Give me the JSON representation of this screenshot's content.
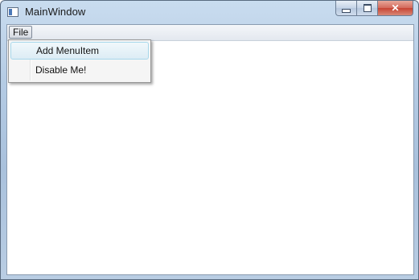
{
  "window": {
    "title": "MainWindow",
    "controls": {
      "minimize_icon": "minimize-icon",
      "maximize_icon": "maximize-icon",
      "close_icon": "close-icon",
      "close_glyph": "✕"
    }
  },
  "menubar": {
    "file_label": "File"
  },
  "file_menu": {
    "items": [
      {
        "label": "Add MenuItem",
        "highlighted": true
      },
      {
        "label": "Disable Me!",
        "highlighted": false
      }
    ]
  },
  "colors": {
    "highlight_border": "#a8d8eb",
    "close_button": "#c74433",
    "frame": "#b4cbe4"
  }
}
